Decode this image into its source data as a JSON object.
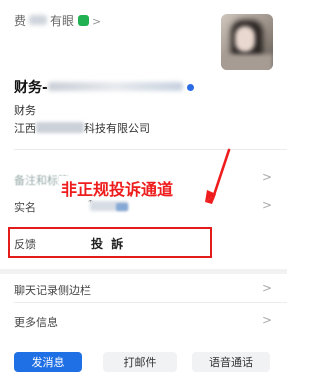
{
  "profile": {
    "top_prefix": "费",
    "top_suffix": "有眼",
    "name_prefix": "财务-",
    "title": "财务",
    "company_prefix": "江西",
    "company_suffix": "科技有限公司"
  },
  "rows": {
    "remarks_label": "备注和标签",
    "realname_label": "实名",
    "realname_star": "*",
    "feedback_label": "反馈",
    "feedback_value": "投 訴",
    "chat_sidebar_label": "聊天记录侧边栏",
    "more_info_label": "更多信息"
  },
  "annotation": {
    "text": "非正规投诉通道",
    "color": "#ee1c1c"
  },
  "buttons": {
    "primary": "发消息",
    "secondary_1": "打邮件",
    "secondary_2": "语音通话"
  },
  "colors": {
    "accent": "#1f6fe5",
    "highlight_box": "#e21b1b"
  }
}
